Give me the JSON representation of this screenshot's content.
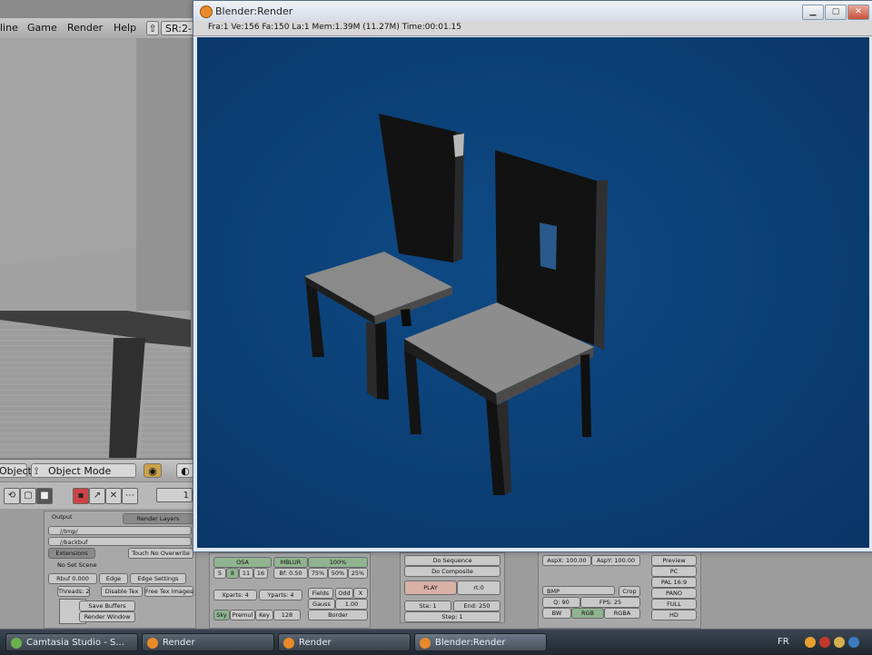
{
  "main_window": {
    "menus": [
      "line",
      "Game",
      "Render",
      "Help"
    ],
    "scene_selector": "SR:2-",
    "header": {
      "object_menu": "Object",
      "mode_select": "Object Mode"
    },
    "frame_field": "1"
  },
  "buttons_window": {
    "output_panel": {
      "title": "Output",
      "tab": "Render Layers",
      "path1": "//tmp/",
      "path2": "//backbuf",
      "extensions": "Extensions",
      "touch_no_overwrite": "Touch  No Overwrite",
      "no_set_scene": "No Set Scene",
      "thread_row": [
        "Rbuf 0.000",
        "Edge",
        "Edge Settings"
      ],
      "threads": "Threads: 2",
      "disable_tex": "Disable Tex",
      "free_tex_images": "Free Tex Images",
      "save_buffers": "Save Buffers",
      "render_window": "Render Window"
    },
    "render_panel": {
      "osa_row": [
        "OSA",
        "MBLUR"
      ],
      "osa_values": [
        "5",
        "8",
        "11",
        "16",
        "Bf: 0.50"
      ],
      "percent_row": [
        "100%",
        "75%",
        "50%",
        "25%"
      ],
      "xparts": "Xparts: 4",
      "yparts": "Yparts: 4",
      "fields": "Fields",
      "odd": "Odd",
      "x": "X",
      "gauss": "Gauss",
      "gauss_val": "1.00",
      "border": "Border",
      "bottom_row": [
        "Sky",
        "Premul",
        "Key",
        "128"
      ]
    },
    "anim_panel": {
      "do_sequence": "Do Sequence",
      "do_composite": "Do Composite",
      "play": "PLAY",
      "rt": "rt:0",
      "sta": "Sta: 1",
      "end": "End: 250",
      "step": "Step: 1"
    },
    "format_panel": {
      "aspx": "AspX: 100.00",
      "aspy": "AspY: 100.00",
      "format": "BMP",
      "crop": "Crop",
      "q": "Q: 90",
      "fps": "FPS: 25",
      "bw": "BW",
      "rgb": "RGB",
      "rgba": "RGBA",
      "presets": [
        "Preview",
        "PC",
        "PAL 16:9",
        "PANO",
        "FULL",
        "HD"
      ]
    }
  },
  "render_window": {
    "title": "Blender:Render",
    "stats": "Fra:1  Ve:156 Fa:150 La:1  Mem:1.39M (11.27M)  Time:00:01.15",
    "controls": [
      "minimize",
      "maximize",
      "close"
    ],
    "background_color": "#0b3f74"
  },
  "taskbar": {
    "tasks": [
      "Camtasia Studio - S...",
      "Render",
      "Render",
      "Blender:Render"
    ],
    "tray_lang": "FR"
  }
}
